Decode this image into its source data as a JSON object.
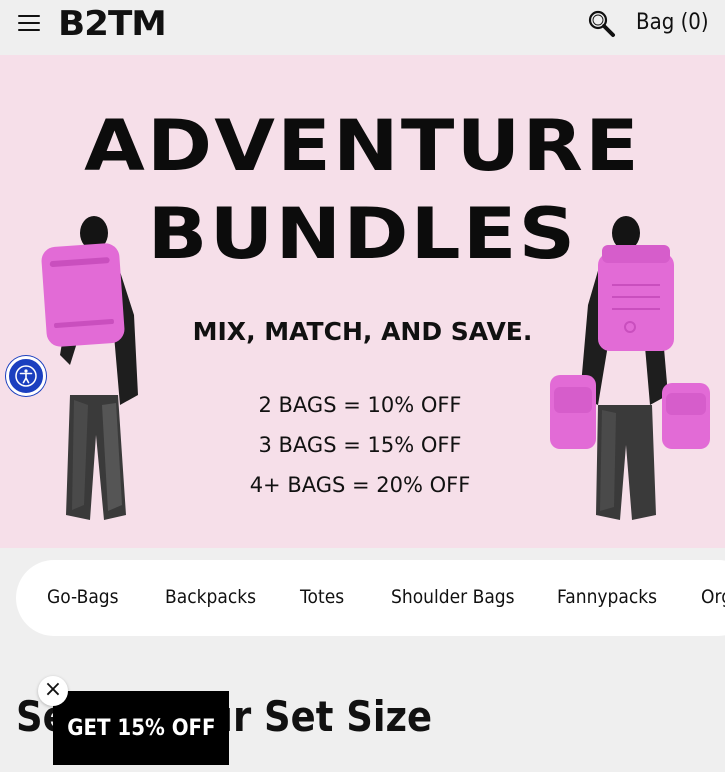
{
  "header": {
    "logo": "B2TM",
    "bag_label": "Bag (0)"
  },
  "hero": {
    "title_line1": "ADVENTURE",
    "title_line2": "BUNDLES",
    "subtitle": "MIX, MATCH, AND SAVE.",
    "deals": [
      "2 BAGS = 10% OFF",
      "3 BAGS = 15% OFF",
      "4+ BAGS = 20% OFF"
    ],
    "background_color": "#f6dfe9",
    "bag_color": "#e26bd6"
  },
  "categories": [
    "Go-Bags",
    "Backpacks",
    "Totes",
    "Shoulder Bags",
    "Fannypacks",
    "Org"
  ],
  "section": {
    "heading": "Select Your Set Size"
  },
  "promo": {
    "label": "GET 15% OFF",
    "close_icon": "×"
  },
  "icons": {
    "menu": "hamburger-menu-icon",
    "search": "search-icon",
    "accessibility": "accessibility-icon"
  }
}
